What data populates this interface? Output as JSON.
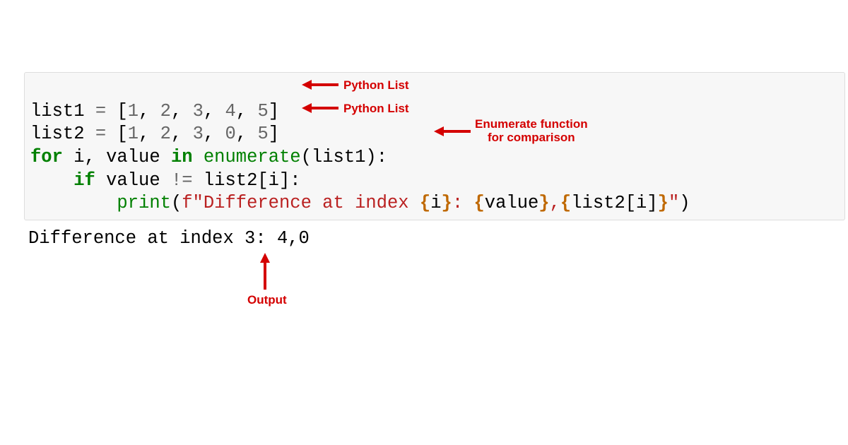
{
  "code": {
    "line1": {
      "var": "list1",
      "assign": " = ",
      "open": "[",
      "n1": "1",
      "c1": ", ",
      "n2": "2",
      "c2": ", ",
      "n3": "3",
      "c3": ", ",
      "n4": "4",
      "c4": ", ",
      "n5": "5",
      "close": "]"
    },
    "line2": {
      "var": "list2",
      "assign": " = ",
      "open": "[",
      "n1": "1",
      "c1": ", ",
      "n2": "2",
      "c2": ", ",
      "n3": "3",
      "c3": ", ",
      "n4": "0",
      "c4": ", ",
      "n5": "5",
      "close": "]"
    },
    "line3": {
      "for": "for",
      "s1": " i, value ",
      "in": "in",
      "s2": " ",
      "enum": "enumerate",
      "tail": "(list1):"
    },
    "line4": {
      "indent": "    ",
      "if": "if",
      "s1": " value ",
      "op": "!=",
      "tail": " list2[i]:"
    },
    "line5": {
      "indent": "        ",
      "print": "print",
      "open": "(",
      "fprefix": "f\"",
      "t1": "Difference at index ",
      "ib1o": "{",
      "ib1c": "i",
      "ib1e": "}",
      "t2": ": ",
      "ib2o": "{",
      "ib2c": "value",
      "ib2e": "}",
      "t3": ",",
      "ib3o": "{",
      "ib3c": "list2[i]",
      "ib3e": "}",
      "send": "\"",
      "close": ")"
    }
  },
  "output": "Difference at index 3: 4,0",
  "annotations": {
    "list1": "Python List",
    "list2": "Python List",
    "enum1": "Enumerate function",
    "enum2": "for comparison",
    "output": "Output"
  },
  "colors": {
    "annotation": "#D40000",
    "keyword": "#008000",
    "string": "#BA2121"
  }
}
